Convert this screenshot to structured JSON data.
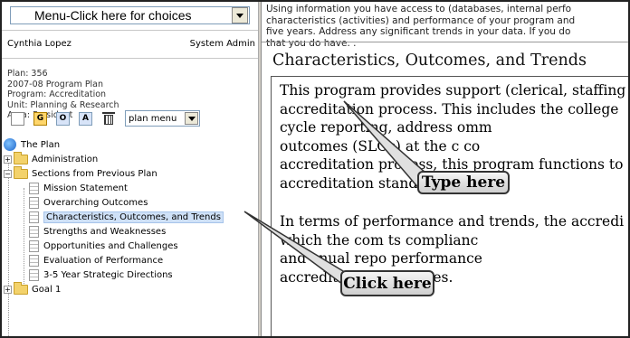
{
  "menu": {
    "label": "Menu-Click here for choices"
  },
  "user": {
    "name": "Cynthia Lopez",
    "role": "System Admin"
  },
  "plan_info": {
    "plan": "Plan: 356",
    "plan_name": "2007-08 Program Plan",
    "program": "Program: Accreditation",
    "unit": "Unit: Planning & Research",
    "area": "Area: President"
  },
  "toolbar": {
    "btn_g": "G",
    "btn_o": "O",
    "btn_a": "A",
    "plan_menu_label": "plan menu"
  },
  "tree": {
    "root": "The Plan",
    "administration": "Administration",
    "sections_prev": "Sections from Previous Plan",
    "items": [
      "Mission Statement",
      "Overarching Outcomes",
      "Characteristics, Outcomes, and Trends",
      "Strengths and Weaknesses",
      "Opportunities and Challenges",
      "Evaluation of Performance",
      "3-5 Year Strategic Directions"
    ],
    "goal1": "Goal 1"
  },
  "instructions": {
    "line1": "Using information you have access to (databases, internal perfo",
    "line2": "characteristics (activities) and performance of your program and",
    "line3": "five years. Address any significant trends in your data. If you do",
    "line4": "that you do have. ."
  },
  "section": {
    "heading": "Characteristics, Outcomes, and Trends"
  },
  "editor": {
    "lines": [
      "This program provides support (clerical, staffing",
      "accreditation process.  This includes the college",
      "cycle reporting, address                      omm",
      "outcomes (SLOs) at the c                       co",
      "accreditation process, this program functions to",
      "accreditation standards.",
      "",
      "In terms of performance and trends, the accredi",
      "which the com                   ts complianc",
      "and anual repo                  performance",
      "accreditation processes."
    ]
  },
  "callouts": {
    "type_here": "Type here",
    "click_here": "Click here"
  }
}
